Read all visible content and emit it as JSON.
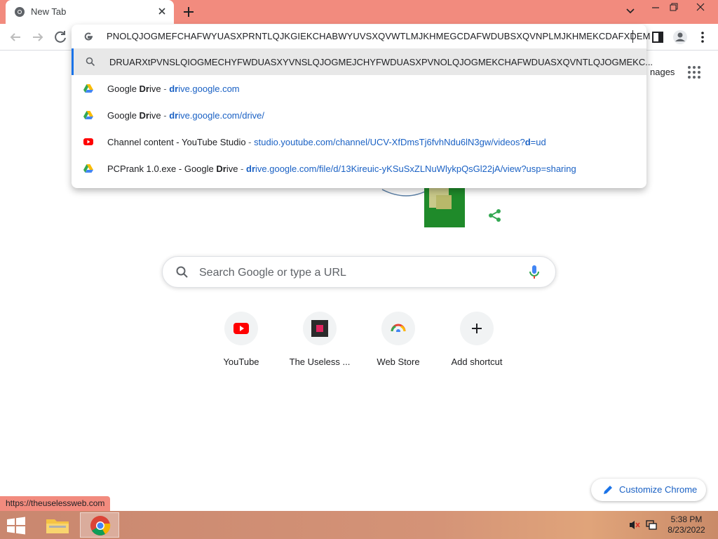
{
  "tab": {
    "title": "New Tab"
  },
  "omnibox": {
    "input_value": "PNOLQJOGMEFCHAFWYUASXPRNTLQJKGIEKCHABWYUVSXQVWTLMJKHMEGCDAFWDUBSXQVNPLMJKHMEKCDAFXDEM",
    "suggestions": [
      {
        "icon": "search-icon",
        "title": "DRUARXtPVNSLQIOGMECHYFWDUASXYVNSLQJOGMEJCHYFWDUASXPVNOLQJOGMEKCHAFWDUASXQVNTLQJOGMEKC...",
        "sep": "",
        "url_bold": "",
        "url_rest": ""
      },
      {
        "icon": "google-drive-icon",
        "title": "Google ",
        "title_bold": "Dr",
        "title_rest": "ive",
        "sep": " - ",
        "url_bold": "dr",
        "url_rest": "ive.google.com"
      },
      {
        "icon": "google-drive-icon",
        "title": "Google ",
        "title_bold": "Dr",
        "title_rest": "ive",
        "sep": " - ",
        "url_bold": "dr",
        "url_rest": "ive.google.com/drive/"
      },
      {
        "icon": "youtube-icon",
        "title": "Channel content - YouTube Studio",
        "title_bold": "",
        "title_rest": "",
        "sep": " - ",
        "url_pre": "studio.youtube.com/channel/UCV-XfDmsTj6fvhNdu6lN3gw/videos?",
        "url_bold": "d",
        "url_rest": "=ud"
      },
      {
        "icon": "google-drive-icon",
        "title": "PCPrank 1.0.exe - Google ",
        "title_bold": "Dr",
        "title_rest": "ive",
        "sep": " - ",
        "url_bold": "dr",
        "url_rest": "ive.google.com/file/d/13Kireuic-yKSuSxZLNuWlykpQsGl22jA/view?usp=sharing"
      }
    ]
  },
  "page": {
    "images_label": "nages",
    "search_placeholder": "Search Google or type a URL",
    "shortcuts": [
      {
        "label": "YouTube",
        "icon": "youtube-icon"
      },
      {
        "label": "The Useless ...",
        "icon": "useless-web-icon"
      },
      {
        "label": "Web Store",
        "icon": "web-store-icon"
      },
      {
        "label": "Add shortcut",
        "icon": "plus-icon"
      }
    ],
    "customize_label": "Customize Chrome",
    "status_url": "https://theuselessweb.com"
  },
  "taskbar": {
    "time": "5:38 PM",
    "date": "8/23/2022"
  },
  "colors": {
    "titlebar": "#f28b7e",
    "accent_blue": "#1a73e8",
    "youtube_red": "#ff0000"
  }
}
